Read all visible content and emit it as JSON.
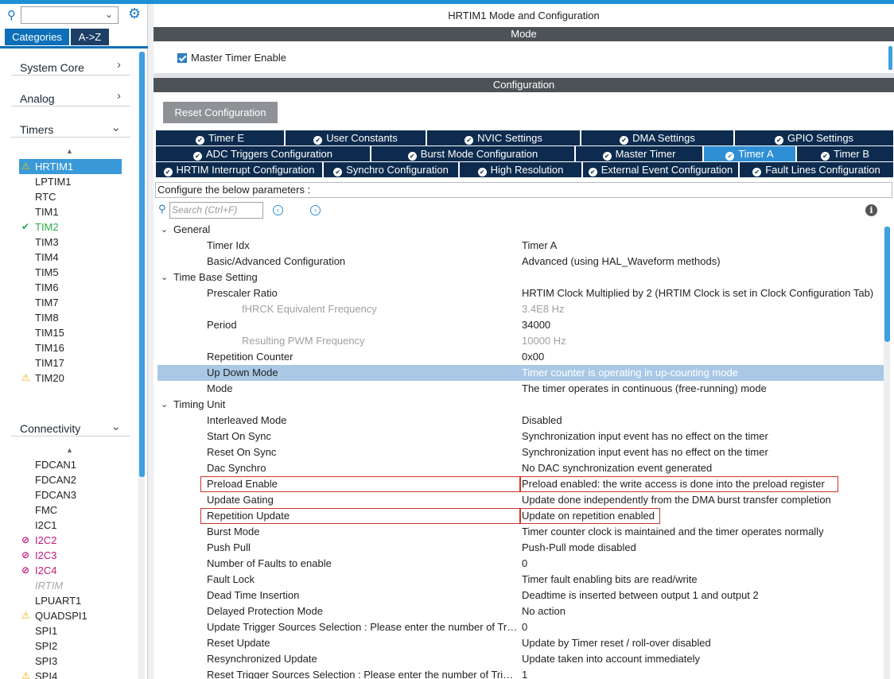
{
  "left_panel": {
    "search": {
      "value": ""
    },
    "tabs": {
      "categories": "Categories",
      "az": "A->Z"
    },
    "categories": [
      {
        "label": "System Core",
        "chevron": "›"
      },
      {
        "label": "Analog",
        "chevron": "›"
      },
      {
        "label": "Timers",
        "chevron": "⌄"
      },
      {
        "label": "Connectivity",
        "chevron": "⌄"
      }
    ],
    "timers": [
      {
        "label": "HRTIM1",
        "status": "warning"
      },
      {
        "label": "LPTIM1",
        "status": "none"
      },
      {
        "label": "RTC",
        "status": "none"
      },
      {
        "label": "TIM1",
        "status": "none"
      },
      {
        "label": "TIM2",
        "status": "configured"
      },
      {
        "label": "TIM3",
        "status": "none"
      },
      {
        "label": "TIM4",
        "status": "none"
      },
      {
        "label": "TIM5",
        "status": "none"
      },
      {
        "label": "TIM6",
        "status": "none"
      },
      {
        "label": "TIM7",
        "status": "none"
      },
      {
        "label": "TIM8",
        "status": "none"
      },
      {
        "label": "TIM15",
        "status": "none"
      },
      {
        "label": "TIM16",
        "status": "none"
      },
      {
        "label": "TIM17",
        "status": "none"
      },
      {
        "label": "TIM20",
        "status": "warning"
      }
    ],
    "connectivity": [
      {
        "label": "FDCAN1",
        "status": "none"
      },
      {
        "label": "FDCAN2",
        "status": "none"
      },
      {
        "label": "FDCAN3",
        "status": "none"
      },
      {
        "label": "FMC",
        "status": "none"
      },
      {
        "label": "I2C1",
        "status": "none"
      },
      {
        "label": "I2C2",
        "status": "conflict"
      },
      {
        "label": "I2C3",
        "status": "conflict"
      },
      {
        "label": "I2C4",
        "status": "conflict"
      },
      {
        "label": "IRTIM",
        "status": "disabled"
      },
      {
        "label": "LPUART1",
        "status": "none"
      },
      {
        "label": "QUADSPI1",
        "status": "warning"
      },
      {
        "label": "SPI1",
        "status": "none"
      },
      {
        "label": "SPI2",
        "status": "none"
      },
      {
        "label": "SPI3",
        "status": "none"
      },
      {
        "label": "SPI4",
        "status": "warning"
      }
    ]
  },
  "right_panel": {
    "title": "HRTIM1 Mode and Configuration",
    "mode_header": "Mode",
    "master_timer_enable": {
      "label": "Master Timer Enable",
      "checked": true
    },
    "config_header": "Configuration",
    "reset_button": "Reset Configuration",
    "tab_rows": [
      [
        {
          "label": "Timer E",
          "active": false
        },
        {
          "label": "User Constants",
          "active": false
        },
        {
          "label": "NVIC Settings",
          "active": false
        },
        {
          "label": "DMA Settings",
          "active": false
        },
        {
          "label": "GPIO Settings",
          "active": false
        }
      ],
      [
        {
          "label": "ADC Triggers Configuration",
          "active": false
        },
        {
          "label": "Burst Mode Configuration",
          "active": false
        },
        {
          "label": "Master Timer",
          "active": false
        },
        {
          "label": "Timer A",
          "active": true
        },
        {
          "label": "Timer B",
          "active": false
        }
      ],
      [
        {
          "label": "HRTIM Interrupt Configuration",
          "active": false
        },
        {
          "label": "Synchro Configuration",
          "active": false
        },
        {
          "label": "High Resolution",
          "active": false
        },
        {
          "label": "External Event Configuration",
          "active": false
        },
        {
          "label": "Fault Lines Configuration",
          "active": false
        }
      ]
    ],
    "configure_hint": "Configure the below parameters :",
    "param_search": {
      "placeholder": "Search (Ctrl+F)"
    },
    "params": [
      {
        "kind": "group",
        "name": "General"
      },
      {
        "kind": "param",
        "name": "Timer Idx",
        "value": "Timer A"
      },
      {
        "kind": "param",
        "name": "Basic/Advanced Configuration",
        "value": "Advanced (using HAL_Waveform methods)"
      },
      {
        "kind": "group",
        "name": "Time Base Setting"
      },
      {
        "kind": "param",
        "name": "Prescaler Ratio",
        "value": "HRTIM Clock Multiplied by 2 (HRTIM Clock is set in Clock Configuration Tab)"
      },
      {
        "kind": "sub",
        "name": "fHRCK Equivalent Frequency",
        "value": "3.4E8 Hz"
      },
      {
        "kind": "param",
        "name": "Period",
        "value": "34000"
      },
      {
        "kind": "sub",
        "name": "Resulting PWM Frequency",
        "value": "10000 Hz"
      },
      {
        "kind": "param",
        "name": "Repetition Counter",
        "value": "0x00"
      },
      {
        "kind": "param",
        "name": "Up Down Mode",
        "value": "Timer counter is operating in up-counting mode",
        "selected": true
      },
      {
        "kind": "param",
        "name": "Mode",
        "value": "The timer operates in continuous (free-running) mode"
      },
      {
        "kind": "group",
        "name": "Timing Unit"
      },
      {
        "kind": "param",
        "name": "Interleaved Mode",
        "value": "Disabled"
      },
      {
        "kind": "param",
        "name": "Start On Sync",
        "value": "Synchronization input event has no effect on the timer"
      },
      {
        "kind": "param",
        "name": "Reset On Sync",
        "value": "Synchronization input event has no effect on the timer"
      },
      {
        "kind": "param",
        "name": "Dac Synchro",
        "value": "No DAC synchronization event generated"
      },
      {
        "kind": "param",
        "name": "Preload Enable",
        "value": "Preload enabled: the write access is done into the preload register",
        "boxed": true
      },
      {
        "kind": "param",
        "name": "Update Gating",
        "value": "Update done independently from the DMA burst transfer completion"
      },
      {
        "kind": "param",
        "name": "Repetition Update",
        "value": "Update on repetition enabled",
        "boxed": true
      },
      {
        "kind": "param",
        "name": "Burst Mode",
        "value": "Timer counter clock is maintained and the timer operates normally"
      },
      {
        "kind": "param",
        "name": "Push Pull",
        "value": "Push-Pull mode disabled"
      },
      {
        "kind": "param",
        "name": "Number of Faults to enable",
        "value": "0"
      },
      {
        "kind": "param",
        "name": "Fault Lock",
        "value": "Timer fault enabling bits are read/write"
      },
      {
        "kind": "param",
        "name": "Dead Time Insertion",
        "value": "Deadtime is inserted between output 1 and output 2"
      },
      {
        "kind": "param",
        "name": "Delayed Protection Mode",
        "value": "No action"
      },
      {
        "kind": "param",
        "name": "Update Trigger Sources Selection : Please enter the number of Triggers",
        "value": "0"
      },
      {
        "kind": "param",
        "name": "Reset Update",
        "value": "Update by Timer reset / roll-over disabled"
      },
      {
        "kind": "param",
        "name": "Resynchronized Update",
        "value": "Update taken into account immediately"
      },
      {
        "kind": "param",
        "name": "Reset Trigger Sources Selection : Please enter the number of Triggers",
        "value": "1"
      }
    ]
  }
}
